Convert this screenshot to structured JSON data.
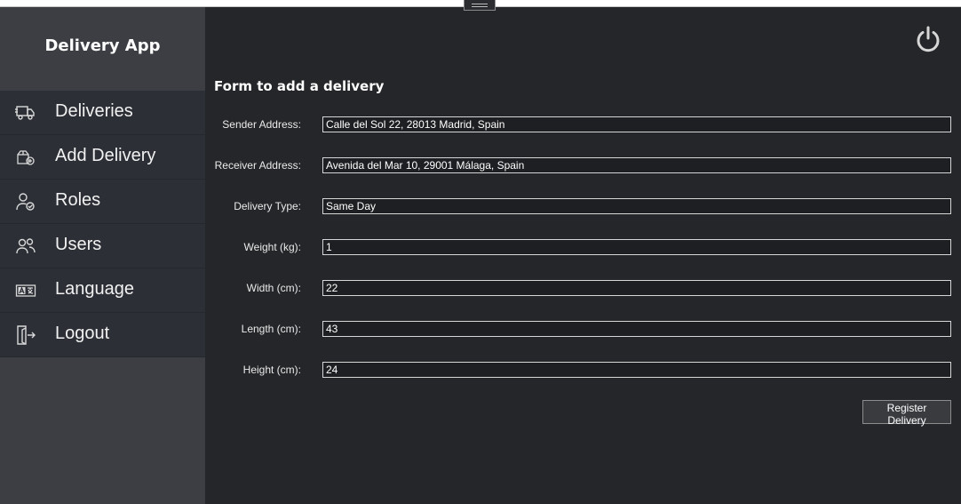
{
  "app": {
    "title": "Delivery App"
  },
  "sidebar": {
    "items": [
      {
        "label": "Deliveries",
        "icon": "truck-icon"
      },
      {
        "label": "Add Delivery",
        "icon": "add-package-icon"
      },
      {
        "label": "Roles",
        "icon": "user-check-icon"
      },
      {
        "label": "Users",
        "icon": "users-icon"
      },
      {
        "label": "Language",
        "icon": "language-icon"
      },
      {
        "label": "Logout",
        "icon": "logout-icon"
      }
    ]
  },
  "header": {
    "power_icon": "power-icon"
  },
  "form": {
    "title": "Form to add a delivery",
    "fields": [
      {
        "label": "Sender Address:",
        "value": "Calle del Sol 22, 28013 Madrid, Spain"
      },
      {
        "label": "Receiver Address:",
        "value": "Avenida del Mar 10, 29001 Málaga, Spain"
      },
      {
        "label": "Delivery Type:",
        "value": "Same Day"
      },
      {
        "label": "Weight (kg):",
        "value": "1"
      },
      {
        "label": "Width (cm):",
        "value": "22"
      },
      {
        "label": "Length (cm):",
        "value": "43"
      },
      {
        "label": "Height (cm):",
        "value": "24"
      }
    ],
    "submit_label": "Register Delivery"
  },
  "colors": {
    "background": "#252629",
    "sidebar": "#3c3e43",
    "nav": "#2c3036",
    "text": "#ffffff"
  }
}
